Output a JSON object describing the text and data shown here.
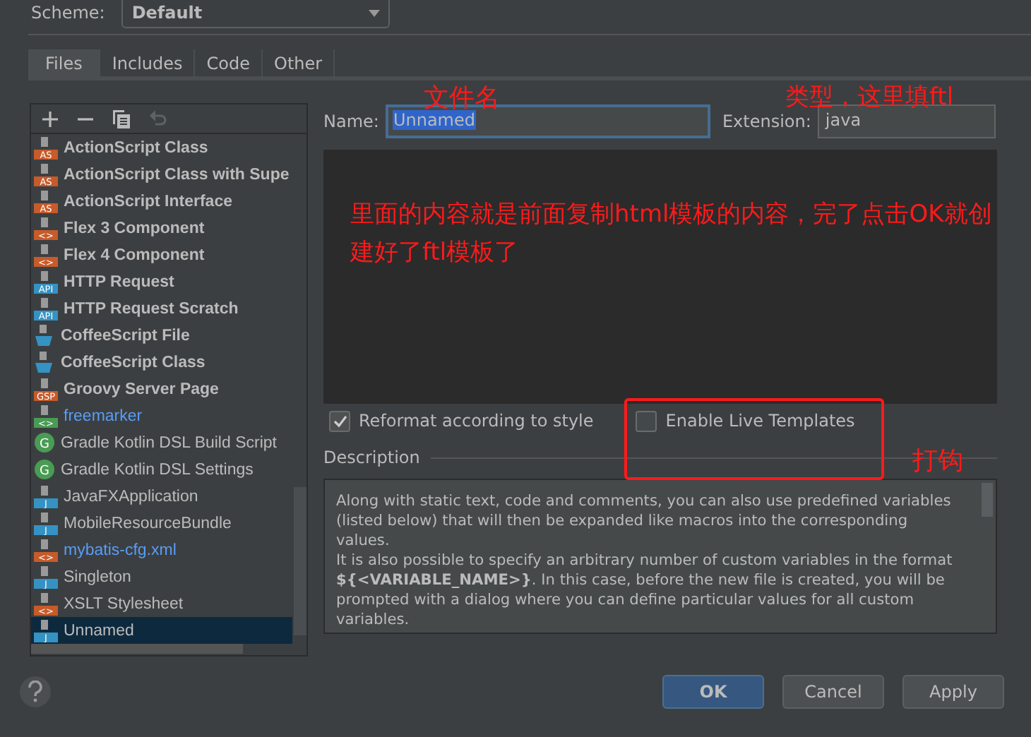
{
  "scheme": {
    "label": "Scheme:",
    "value": "Default"
  },
  "tabs": [
    {
      "label": "Files",
      "selected": true
    },
    {
      "label": "Includes",
      "selected": false
    },
    {
      "label": "Code",
      "selected": false
    },
    {
      "label": "Other",
      "selected": false
    }
  ],
  "templates": [
    {
      "label": "ActionScript Class",
      "badge": "AS",
      "kind": "as",
      "bold": true,
      "color": "#bbbbbb",
      "selected": false
    },
    {
      "label": "ActionScript Class with Supe",
      "badge": "AS",
      "kind": "as",
      "bold": true,
      "color": "#bbbbbb",
      "selected": false
    },
    {
      "label": "ActionScript Interface",
      "badge": "AS",
      "kind": "as",
      "bold": true,
      "color": "#bbbbbb",
      "selected": false
    },
    {
      "label": "Flex 3 Component",
      "badge": "<>",
      "kind": "flex",
      "bold": true,
      "color": "#bbbbbb",
      "selected": false
    },
    {
      "label": "Flex 4 Component",
      "badge": "<>",
      "kind": "flex",
      "bold": true,
      "color": "#bbbbbb",
      "selected": false
    },
    {
      "label": "HTTP Request",
      "badge": "API",
      "kind": "api",
      "bold": true,
      "color": "#bbbbbb",
      "selected": false
    },
    {
      "label": "HTTP Request Scratch",
      "badge": "API",
      "kind": "api",
      "bold": true,
      "color": "#bbbbbb",
      "selected": false
    },
    {
      "label": "CoffeeScript File",
      "kind": "coffee",
      "bold": true,
      "color": "#bbbbbb",
      "selected": false
    },
    {
      "label": "CoffeeScript Class",
      "kind": "coffee",
      "bold": true,
      "color": "#bbbbbb",
      "selected": false
    },
    {
      "label": "Groovy Server Page",
      "badge": "GSP",
      "kind": "gsp",
      "bold": true,
      "color": "#bbbbbb",
      "selected": false
    },
    {
      "label": "freemarker",
      "badge": "<>",
      "kind": "ftl",
      "bold": false,
      "color": "#589df6",
      "selected": false
    },
    {
      "label": "Gradle Kotlin DSL Build Script",
      "badge": "G",
      "kind": "gradle",
      "bold": false,
      "color": "#bbbbbb",
      "selected": false
    },
    {
      "label": "Gradle Kotlin DSL Settings",
      "badge": "G",
      "kind": "gradle",
      "bold": false,
      "color": "#bbbbbb",
      "selected": false
    },
    {
      "label": "JavaFXApplication",
      "badge": "J",
      "kind": "java",
      "bold": false,
      "color": "#bbbbbb",
      "selected": false
    },
    {
      "label": "MobileResourceBundle",
      "badge": "J",
      "kind": "java",
      "bold": false,
      "color": "#bbbbbb",
      "selected": false
    },
    {
      "label": "mybatis-cfg.xml",
      "badge": "<>",
      "kind": "xml",
      "bold": false,
      "color": "#589df6",
      "selected": false
    },
    {
      "label": "Singleton",
      "badge": "J",
      "kind": "java",
      "bold": false,
      "color": "#bbbbbb",
      "selected": false
    },
    {
      "label": "XSLT Stylesheet",
      "badge": "<>",
      "kind": "xml",
      "bold": false,
      "color": "#bbbbbb",
      "selected": false
    },
    {
      "label": "Unnamed",
      "badge": "J",
      "kind": "java",
      "bold": false,
      "color": "#bbbbbb",
      "selected": true
    }
  ],
  "name": {
    "label": "Name:",
    "value": "Unnamed"
  },
  "extension": {
    "label": "Extension:",
    "value": "java"
  },
  "options": [
    {
      "label": "Reformat according to style",
      "checked": true
    },
    {
      "label": "Enable Live Templates",
      "checked": false
    }
  ],
  "description": {
    "title": "Description",
    "paragraphs": [
      "Along with static text, code and comments, you can also use predefined variables (listed below) that will then be expanded like macros into the corresponding values.",
      "It is also possible to specify an arbitrary number of custom variables in the format **${<VARIABLE_NAME>}**. In this case, before the new file is created, you will be prompted with a dialog where you can define particular values for all custom variables."
    ]
  },
  "buttons": [
    {
      "label": "OK",
      "default": true
    },
    {
      "label": "Cancel",
      "default": false
    },
    {
      "label": "Apply",
      "default": false
    }
  ],
  "annotations": {
    "name_note": "文件名",
    "extension_note": "类型，这里填ftl",
    "content_note": "里面的内容就是前面复制html模板的内容，完了点击OK就创建好了ftl模板了",
    "checkbox_note": "打钩"
  }
}
